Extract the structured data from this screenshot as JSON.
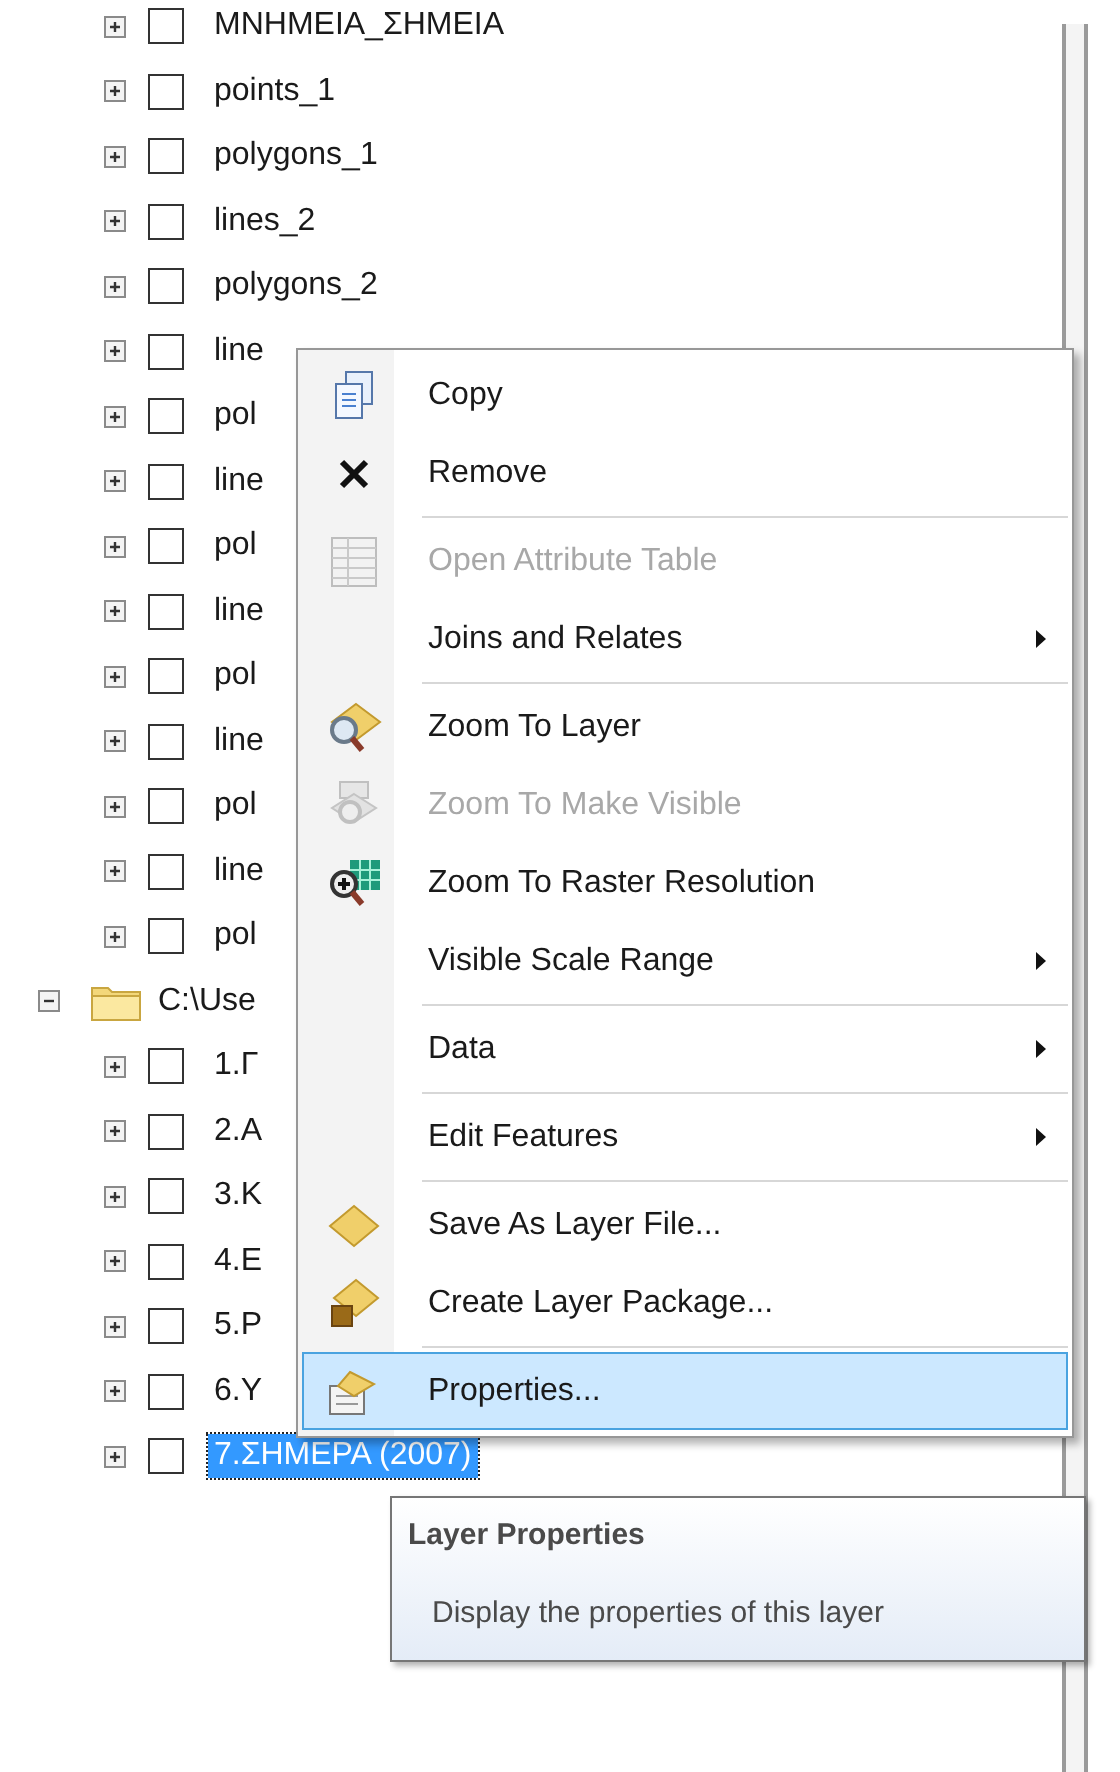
{
  "tree": {
    "layers": [
      {
        "name": "ΜΝΗΜΕΙΑ_ΣΗΜΕΙΑ",
        "checked": false
      },
      {
        "name": "points_1",
        "checked": false
      },
      {
        "name": "polygons_1",
        "checked": false
      },
      {
        "name": "lines_2",
        "checked": false
      },
      {
        "name": "polygons_2",
        "checked": false
      },
      {
        "name": "line",
        "checked": false
      },
      {
        "name": "pol",
        "checked": false
      },
      {
        "name": "line",
        "checked": false
      },
      {
        "name": "pol",
        "checked": false
      },
      {
        "name": "line",
        "checked": false
      },
      {
        "name": "pol",
        "checked": false
      },
      {
        "name": "line",
        "checked": false
      },
      {
        "name": "pol",
        "checked": false
      },
      {
        "name": "line",
        "checked": false
      },
      {
        "name": "pol",
        "checked": false
      }
    ],
    "folder": {
      "name": "C:\\Use",
      "expanded": true,
      "layers": [
        {
          "name": "1.Γ",
          "checked": false,
          "selected": false
        },
        {
          "name": "2.A",
          "checked": false,
          "selected": false
        },
        {
          "name": "3.K",
          "checked": false,
          "selected": false
        },
        {
          "name": "4.E",
          "checked": false,
          "selected": false
        },
        {
          "name": "5.P",
          "checked": false,
          "selected": false
        },
        {
          "name": "6.Y",
          "checked": false,
          "selected": false
        },
        {
          "name": "7.ΣΗΜΕΡΑ (2007)",
          "checked": false,
          "selected": true
        }
      ]
    }
  },
  "context_menu": {
    "items": [
      {
        "kind": "item",
        "label": "Copy",
        "disabled": false,
        "submenu": false,
        "selected": false
      },
      {
        "kind": "item",
        "label": "Remove",
        "disabled": false,
        "submenu": false,
        "selected": false
      },
      {
        "kind": "separator"
      },
      {
        "kind": "item",
        "label": "Open Attribute Table",
        "disabled": true,
        "submenu": false,
        "selected": false
      },
      {
        "kind": "item",
        "label": "Joins and Relates",
        "disabled": false,
        "submenu": true,
        "selected": false
      },
      {
        "kind": "separator"
      },
      {
        "kind": "item",
        "label": "Zoom To Layer",
        "disabled": false,
        "submenu": false,
        "selected": false
      },
      {
        "kind": "item",
        "label": "Zoom To Make Visible",
        "disabled": true,
        "submenu": false,
        "selected": false
      },
      {
        "kind": "item",
        "label": "Zoom To Raster Resolution",
        "disabled": false,
        "submenu": false,
        "selected": false
      },
      {
        "kind": "item",
        "label": "Visible Scale Range",
        "disabled": false,
        "submenu": true,
        "selected": false
      },
      {
        "kind": "separator"
      },
      {
        "kind": "item",
        "label": "Data",
        "disabled": false,
        "submenu": true,
        "selected": false
      },
      {
        "kind": "separator"
      },
      {
        "kind": "item",
        "label": "Edit Features",
        "disabled": false,
        "submenu": true,
        "selected": false
      },
      {
        "kind": "separator"
      },
      {
        "kind": "item",
        "label": "Save As Layer File...",
        "disabled": false,
        "submenu": false,
        "selected": false
      },
      {
        "kind": "item",
        "label": "Create Layer Package...",
        "disabled": false,
        "submenu": false,
        "selected": false
      },
      {
        "kind": "separator"
      },
      {
        "kind": "item",
        "label": "Properties...",
        "disabled": false,
        "submenu": false,
        "selected": true
      }
    ]
  },
  "tooltip": {
    "title": "Layer Properties",
    "description": "Display the properties of this layer"
  }
}
